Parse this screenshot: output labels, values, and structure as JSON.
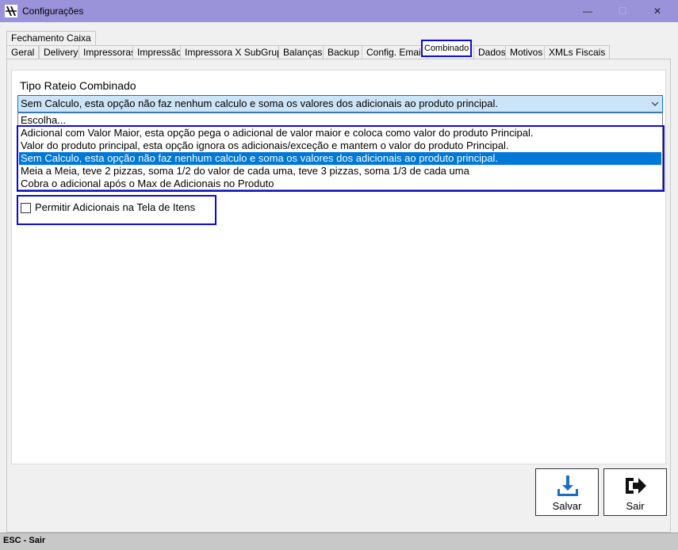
{
  "window": {
    "title": "Configurações",
    "controls": {
      "minimize": "—",
      "maximize": "☐",
      "close": "✕"
    }
  },
  "tabs": {
    "row1": [
      {
        "label": "Fechamento Caixa"
      }
    ],
    "row2": [
      {
        "label": "Geral"
      },
      {
        "label": "Delivery"
      },
      {
        "label": "Impressoras"
      },
      {
        "label": "Impressão"
      },
      {
        "label": "Impressora X SubGrupo"
      },
      {
        "label": "Balanças"
      },
      {
        "label": "Backup"
      },
      {
        "label": "Config. Email"
      },
      {
        "label": "Combinado",
        "active": true
      },
      {
        "label": "Dados"
      },
      {
        "label": "Motivos"
      },
      {
        "label": "XMLs Fiscais"
      }
    ]
  },
  "combinado": {
    "rateio_label": "Tipo Rateio Combinado",
    "selected_value": "Sem Calculo, esta opção não faz nenhum calculo e soma os valores dos adicionais ao produto principal.",
    "options": [
      "Escolha...",
      "Adicional com Valor Maior, esta opção pega o adicional de valor maior e coloca como valor do produto Principal.",
      "Valor do produto principal, esta opção ignora os adicionais/exceção e mantem o valor do produto Principal.",
      "Sem Calculo, esta opção não faz nenhum calculo e soma os valores dos adicionais ao produto principal.",
      "Meia a Meia, teve 2 pizzas, soma 1/2 do valor de cada uma, teve 3 pizzas, soma 1/3 de cada uma",
      "Cobra o adicional após o Max de Adicionais no Produto"
    ],
    "selected_index": 3,
    "checkbox_label": "Permitir Adicionais na Tela de Itens",
    "checkbox_checked": false
  },
  "buttons": {
    "save": "Salvar",
    "exit": "Sair"
  },
  "status": {
    "text": "ESC - Sair"
  },
  "colors": {
    "titlebar": "#9a93da",
    "highlight": "#0a0adc",
    "selection": "#0078d7"
  },
  "icons": {
    "save": "download-tray-icon",
    "exit": "exit-arrow-icon",
    "combo": "chevron-down-icon"
  }
}
